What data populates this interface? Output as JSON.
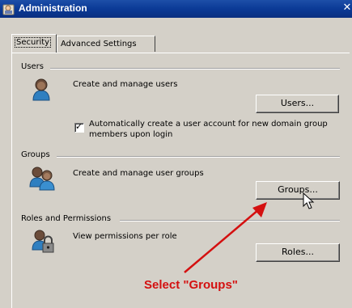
{
  "window": {
    "title": "Administration",
    "close_glyph": "✕"
  },
  "tabs": [
    {
      "label": "Security",
      "active": true
    },
    {
      "label": "Advanced Settings",
      "active": false
    }
  ],
  "users": {
    "section_label": "Users",
    "description": "Create and manage users",
    "button_label": "Users...",
    "checkbox_label_line1": "Automatically create a user account for new domain group",
    "checkbox_label_line2": "members upon login",
    "checkbox_checked": true,
    "icon": "user-icon"
  },
  "groups": {
    "section_label": "Groups",
    "description": "Create and manage user groups",
    "button_label": "Groups...",
    "icon": "group-icon"
  },
  "roles": {
    "section_label": "Roles and Permissions",
    "description": "View permissions per role",
    "button_label": "Roles...",
    "icon": "role-lock-icon"
  },
  "annotation": {
    "text": "Select \"Groups\"",
    "color": "#d41010"
  }
}
